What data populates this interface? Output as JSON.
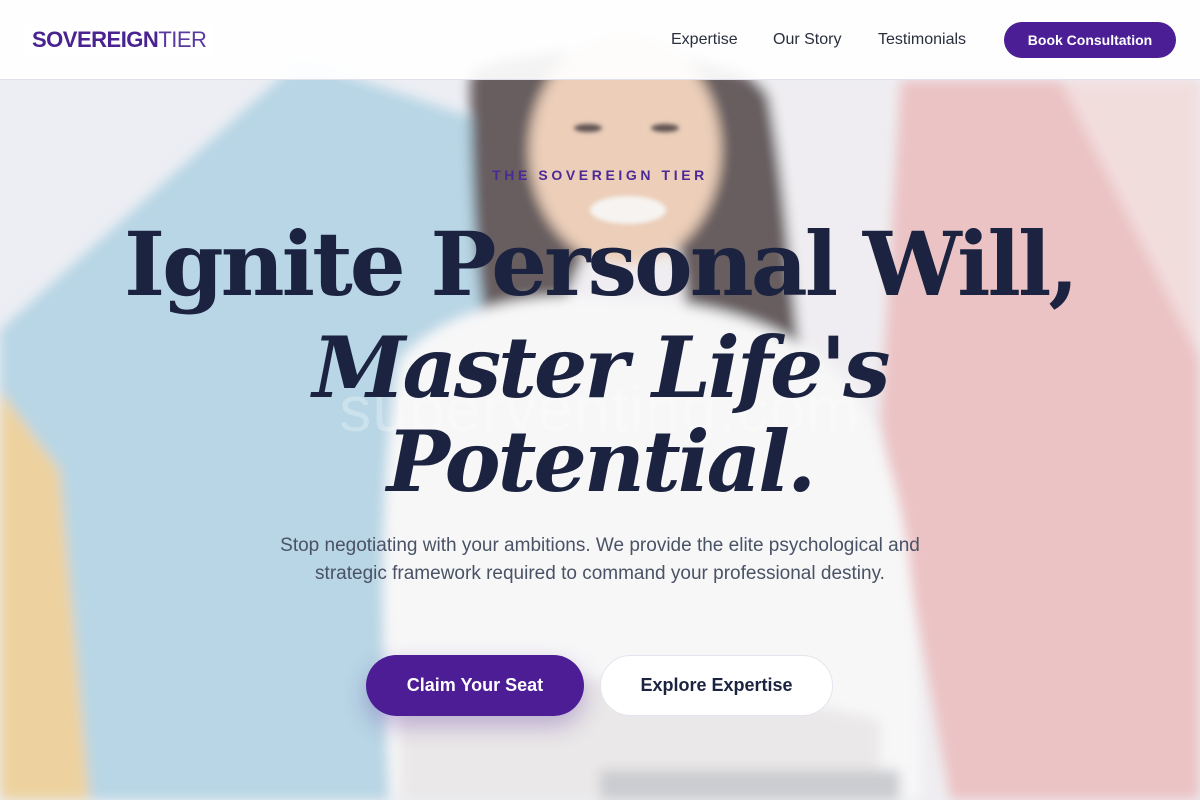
{
  "brand": {
    "logo_bold": "SOVEREIGN",
    "logo_light": "TIER"
  },
  "nav": {
    "links": [
      "Expertise",
      "Our Story",
      "Testimonials"
    ],
    "cta_label": "Book Consultation"
  },
  "hero": {
    "eyebrow": "THE SOVEREIGN TIER",
    "headline_line1": "Ignite Personal Will,",
    "headline_line2": "Master Life's",
    "headline_line3": "Potential.",
    "subtitle": "Stop negotiating with your ambitions. We provide the elite psychological and strategic framework required to command your professional destiny.",
    "primary_button": "Claim Your Seat",
    "secondary_button": "Explore Expertise",
    "watermark": "superventing.com"
  },
  "colors": {
    "brand_purple": "#4c1d95",
    "headline_navy": "#1b2340",
    "text_gray": "#4a5266"
  }
}
